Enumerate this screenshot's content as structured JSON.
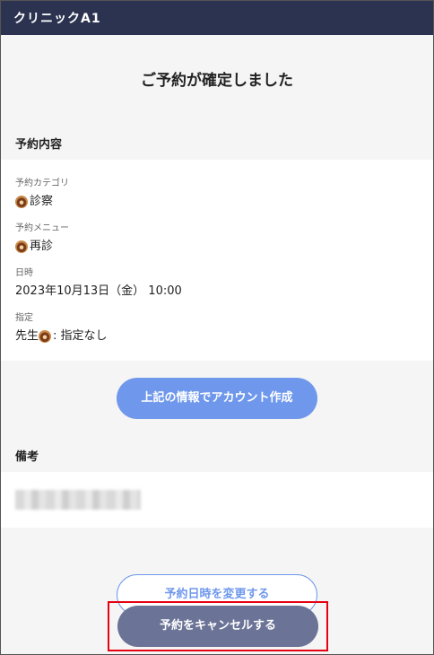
{
  "header": {
    "title": "クリニックA1"
  },
  "page_title": "ご予約が確定しました",
  "reservation": {
    "section_label": "予約内容",
    "category": {
      "label": "予約カテゴリ",
      "value": "診察",
      "icon": "donut-icon"
    },
    "menu": {
      "label": "予約メニュー",
      "value": "再診",
      "icon": "donut-icon"
    },
    "datetime": {
      "label": "日時",
      "value": "2023年10月13日（金） 10:00"
    },
    "designation": {
      "label": "指定",
      "value_prefix": "先生",
      "value_suffix": ": 指定なし",
      "icon": "donut-icon"
    }
  },
  "buttons": {
    "create_account": "上記の情報でアカウント作成",
    "change_datetime": "予約日時を変更する",
    "cancel": "予約をキャンセルする"
  },
  "notes": {
    "section_label": "備考"
  },
  "colors": {
    "header_bg": "#2b3350",
    "primary": "#6f98ec",
    "cancel_bg": "#6b7397",
    "highlight": "#e60012"
  }
}
